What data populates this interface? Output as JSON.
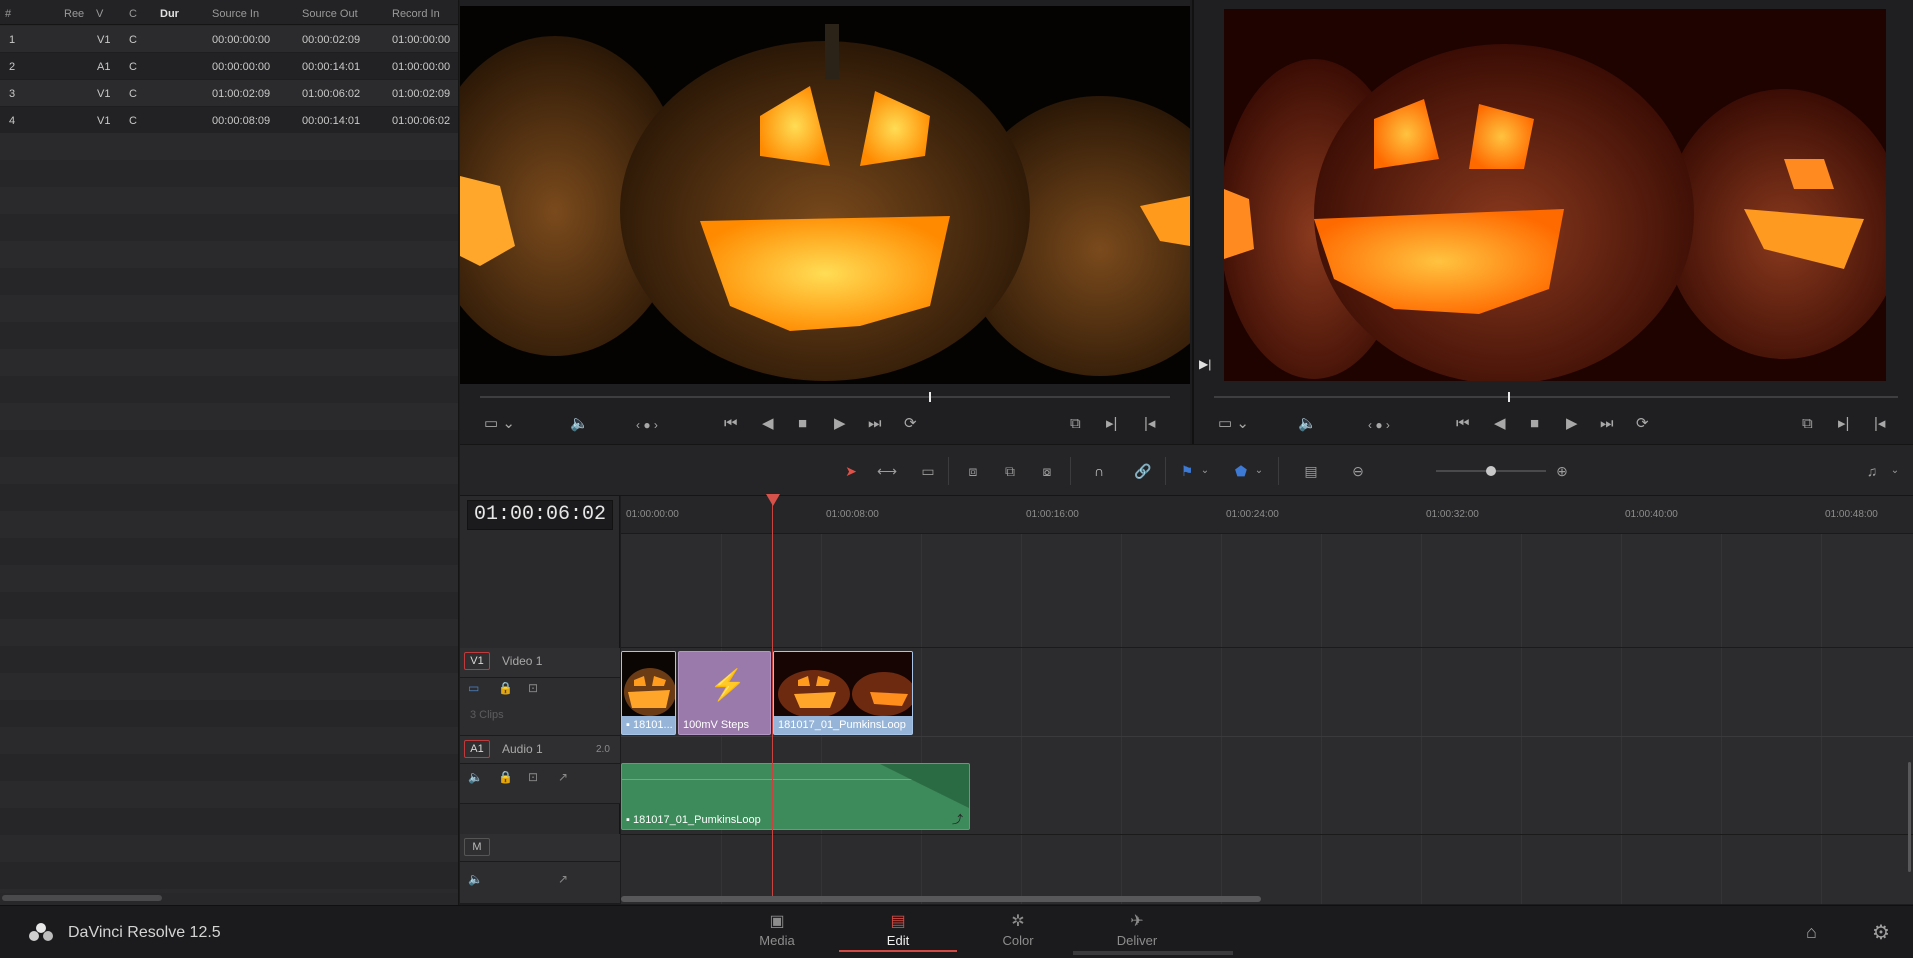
{
  "edit_index": {
    "columns": [
      "#",
      "Ree",
      "V",
      "C",
      "Dur",
      "Source In",
      "Source Out",
      "Record In"
    ],
    "rows": [
      [
        "1",
        "",
        "V1",
        "C",
        "",
        "00:00:00:00",
        "00:00:02:09",
        "01:00:00:00"
      ],
      [
        "2",
        "",
        "A1",
        "C",
        "",
        "00:00:00:00",
        "00:00:14:01",
        "01:00:00:00"
      ],
      [
        "3",
        "",
        "V1",
        "C",
        "",
        "01:00:02:09",
        "01:00:06:02",
        "01:00:02:09"
      ],
      [
        "4",
        "",
        "V1",
        "C",
        "",
        "00:00:08:09",
        "00:00:14:01",
        "01:00:06:02"
      ]
    ]
  },
  "source_viewer": {
    "scrub_position": 0.65
  },
  "program_viewer": {
    "scrub_position": 0.43
  },
  "timeline": {
    "timecode": "01:00:06:02",
    "ruler_labels": [
      "01:00:00:00",
      "01:00:08:00",
      "01:00:16:00",
      "01:00:24:00",
      "01:00:32:00",
      "01:00:40:00",
      "01:00:48:00"
    ],
    "tracks": {
      "video1": {
        "badge": "V1",
        "name": "Video 1",
        "clip_count": "3 Clips"
      },
      "audio1": {
        "badge": "A1",
        "name": "Audio 1",
        "channels": "2.0"
      },
      "master": {
        "badge": "M"
      }
    },
    "clips": {
      "v1_clip1": "▪ 18101...",
      "v1_clip2": "100mV Steps",
      "v1_clip3": "181017_01_PumkinsLoop",
      "a1_clip1": "▪ 181017_01_PumkinsLoop"
    },
    "zoom_level": 0.5
  },
  "app": {
    "name": "DaVinci Resolve 12.5"
  },
  "pages": [
    {
      "label": "Media",
      "icon": "media-icon"
    },
    {
      "label": "Edit",
      "icon": "edit-icon",
      "active": true
    },
    {
      "label": "Color",
      "icon": "color-icon"
    },
    {
      "label": "Deliver",
      "icon": "deliver-icon"
    }
  ],
  "colors": {
    "accent": "#d24a43",
    "video_clip": "#95b4d8",
    "generator_clip": "#9a7aab",
    "audio_clip": "#3d8a5a"
  }
}
